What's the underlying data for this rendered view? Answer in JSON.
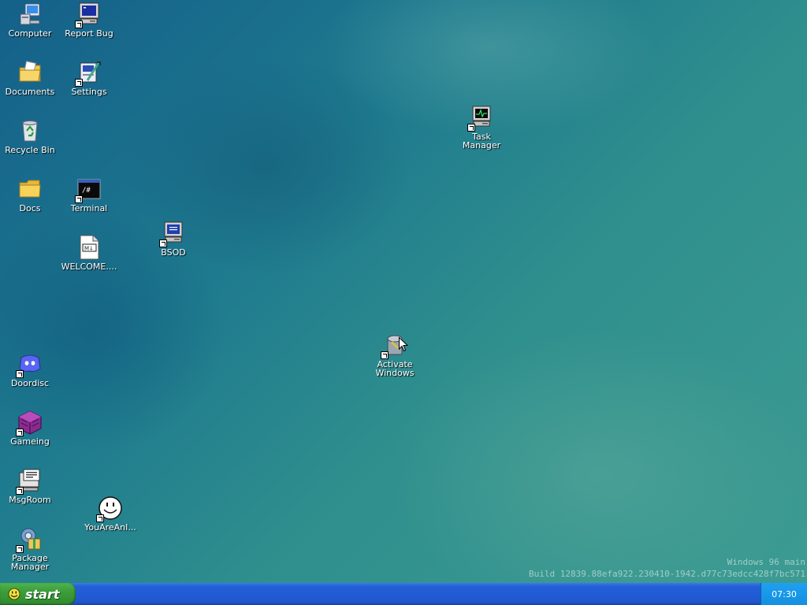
{
  "desktop": {
    "icons": [
      {
        "label": "Computer"
      },
      {
        "label": "Report Bug"
      },
      {
        "label": "Documents"
      },
      {
        "label": "Settings"
      },
      {
        "label": "Recycle Bin"
      },
      {
        "label": "Docs"
      },
      {
        "label": "Terminal"
      },
      {
        "label": "WELCOME...."
      },
      {
        "label": "BSOD"
      },
      {
        "label": "Task\nManager"
      },
      {
        "label": "Activate\nWindows"
      },
      {
        "label": "Doordisc"
      },
      {
        "label": "Gameing"
      },
      {
        "label": "MsgRoom"
      },
      {
        "label": "YouAreAnI..."
      },
      {
        "label": "Package\nManager"
      }
    ],
    "terminal_glyph": "/#",
    "welcome_glyph": "M↓"
  },
  "watermark": {
    "line1": "Windows 96 main",
    "line2": "Build 12839.88efa922.230410-1942.d77c73edcc428f7bc571"
  },
  "taskbar": {
    "start_label": "start",
    "clock": "07:30"
  },
  "colors": {
    "taskbar": "#2460d8",
    "start": "#3c9d3a",
    "tray": "#1fa0f0"
  }
}
